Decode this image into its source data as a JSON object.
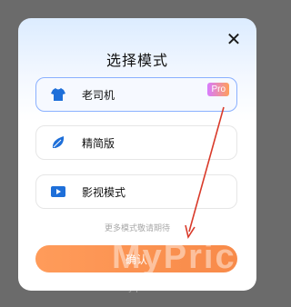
{
  "dialog": {
    "title": "选择模式",
    "close_icon": "close-icon",
    "options": [
      {
        "label": "老司机",
        "icon": "tshirt-icon",
        "badge": "Pro",
        "selected": true
      },
      {
        "label": "精简版",
        "icon": "leaf-icon",
        "selected": false
      },
      {
        "label": "影视模式",
        "icon": "play-icon",
        "selected": false
      }
    ],
    "hint": "更多模式敬请期待",
    "confirm_label": "确认"
  },
  "watermark": {
    "text": "MyPric",
    "sub": "myprice.com.cn"
  },
  "colors": {
    "accent": "#f7762a",
    "selected_border": "#8ab0ff",
    "icon_blue": "#1e6fd9",
    "arrow": "#d93a2a"
  }
}
